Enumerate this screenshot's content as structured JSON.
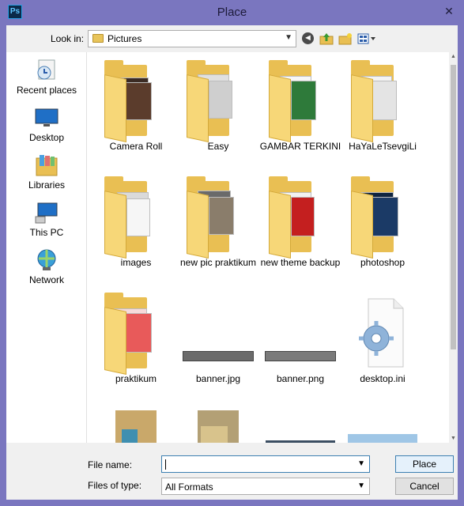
{
  "window": {
    "title": "Place",
    "app_icon_text": "Ps",
    "close_glyph": "✕"
  },
  "toolbar": {
    "look_in_label": "Look in:",
    "look_in_value": "Pictures",
    "back_glyph": "◄"
  },
  "places": [
    {
      "label": "Recent places",
      "icon": "recent-places-icon"
    },
    {
      "label": "Desktop",
      "icon": "desktop-icon"
    },
    {
      "label": "Libraries",
      "icon": "libraries-icon"
    },
    {
      "label": "This PC",
      "icon": "this-pc-icon"
    },
    {
      "label": "Network",
      "icon": "network-icon"
    }
  ],
  "files": [
    {
      "label": "Camera Roll",
      "kind": "folder"
    },
    {
      "label": "Easy",
      "kind": "folder"
    },
    {
      "label": "GAMBAR TERKINI",
      "kind": "folder"
    },
    {
      "label": "HaYaLeTsevgiLi",
      "kind": "folder"
    },
    {
      "label": "images",
      "kind": "folder"
    },
    {
      "label": "new pic praktikum",
      "kind": "folder"
    },
    {
      "label": "new theme backup",
      "kind": "folder"
    },
    {
      "label": "photoshop",
      "kind": "folder"
    },
    {
      "label": "praktikum",
      "kind": "folder"
    },
    {
      "label": "banner.jpg",
      "kind": "image"
    },
    {
      "label": "banner.png",
      "kind": "image"
    },
    {
      "label": "desktop.ini",
      "kind": "settings-file"
    },
    {
      "label": "",
      "kind": "photo"
    },
    {
      "label": "",
      "kind": "photo"
    },
    {
      "label": "",
      "kind": "photo"
    },
    {
      "label": "",
      "kind": "photo"
    }
  ],
  "bottom": {
    "file_name_label": "File name:",
    "file_name_value": "",
    "files_of_type_label": "Files of type:",
    "files_of_type_value": "All Formats",
    "place_button": "Place",
    "cancel_button": "Cancel"
  },
  "colors": {
    "titlebar": "#7a76bf",
    "folder": "#e9bf53",
    "dialog_bg": "#f0f0f0"
  }
}
